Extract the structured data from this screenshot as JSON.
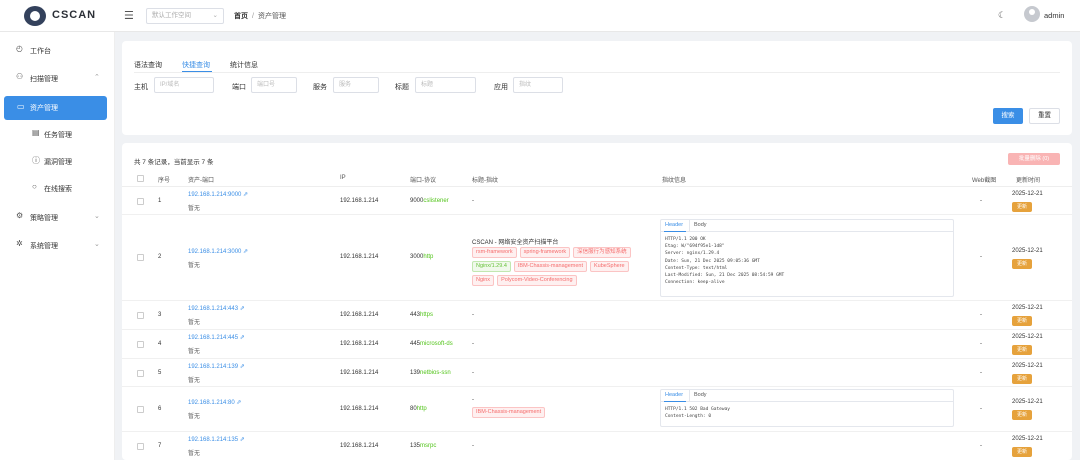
{
  "app": {
    "logo_text": "CSCAN"
  },
  "topbar": {
    "workspace_placeholder": "默认工作空间",
    "breadcrumb": [
      "首页",
      "资产管理"
    ],
    "breadcrumb_sep": "/",
    "user": "admin"
  },
  "sidebar": {
    "items": [
      {
        "label": "工作台",
        "icon": "dashboard-icon"
      },
      {
        "label": "扫描管理",
        "icon": "scan-icon",
        "arrow": "⌃"
      },
      {
        "label": "资产管理",
        "icon": "monitor-icon",
        "active": true
      },
      {
        "label": "任务管理",
        "icon": "task-icon"
      },
      {
        "label": "漏洞管理",
        "icon": "vuln-icon"
      },
      {
        "label": "在线搜索",
        "icon": "search-icon"
      },
      {
        "label": "策略管理",
        "icon": "policy-icon",
        "arrow": "⌄"
      },
      {
        "label": "系统管理",
        "icon": "gear-icon",
        "arrow": "⌄"
      }
    ]
  },
  "search": {
    "tabs": [
      "语法查询",
      "快捷查询",
      "统计信息"
    ],
    "active_tab": "快捷查询",
    "fields": [
      {
        "label": "主机",
        "placeholder": "IP/域名"
      },
      {
        "label": "端口",
        "placeholder": "端口号"
      },
      {
        "label": "服务",
        "placeholder": "服务"
      },
      {
        "label": "标题",
        "placeholder": "标题"
      },
      {
        "label": "应用",
        "placeholder": "指纹"
      }
    ],
    "search_button": "搜索",
    "reset_button": "重置"
  },
  "table": {
    "count_text": "共 7 条记录，当前显示 7 条",
    "batch_delete": "批量删除 (0)",
    "columns": [
      "序号",
      "资产-端口",
      "IP",
      "端口-协议",
      "标题-指纹",
      "指纹信息",
      "Web截图",
      "更新时间"
    ],
    "rows": [
      {
        "no": "1",
        "asset": "192.168.1.214:9000",
        "sub": "暂无",
        "ip": "192.168.1.214",
        "port": "9000",
        "service": "cslistener",
        "title": "-",
        "screenshot": "-",
        "date": "2025-12-21",
        "badge": "更新"
      },
      {
        "no": "2",
        "asset": "192.168.1.214:3000",
        "sub": "暂无",
        "ip": "192.168.1.214",
        "port": "3000",
        "service": "http",
        "title": "CSCAN - 网络安全资产扫描平台",
        "tags": [
          {
            "text": "rsm-framework",
            "color": "red"
          },
          {
            "text": "spring-framework",
            "color": "red"
          },
          {
            "text": "深信服行为感知系统",
            "color": "red"
          },
          {
            "text": "Nginx/1.29.4",
            "color": "green"
          },
          {
            "text": "IBM-Chassis-management",
            "color": "red"
          },
          {
            "text": "KubeSphere",
            "color": "red"
          },
          {
            "text": "Nginx",
            "color": "red"
          },
          {
            "text": "Polycom-Video-Conferencing",
            "color": "red"
          }
        ],
        "header_tabs": [
          "Header",
          "Body"
        ],
        "header": "HTTP/1.1 200 OK\nEtag: W/\"694f95e1-1d8\"\nServer: nginx/1.29.4\nDate: Sun, 21 Dec 2025 09:05:36 GMT\nContent-Type: text/html\nLast-Modified: Sun, 21 Dec 2025 08:54:59 GMT\nConnection: keep-alive",
        "screenshot": "-",
        "date": "2025-12-21",
        "badge": "更新"
      },
      {
        "no": "3",
        "asset": "192.168.1.214:443",
        "sub": "暂无",
        "ip": "192.168.1.214",
        "port": "443",
        "service": "https",
        "title": "-",
        "screenshot": "-",
        "date": "2025-12-21",
        "badge": "更新"
      },
      {
        "no": "4",
        "asset": "192.168.1.214:445",
        "sub": "暂无",
        "ip": "192.168.1.214",
        "port": "445",
        "service": "microsoft-ds",
        "title": "-",
        "screenshot": "-",
        "date": "2025-12-21",
        "badge": "更新"
      },
      {
        "no": "5",
        "asset": "192.168.1.214:139",
        "sub": "暂无",
        "ip": "192.168.1.214",
        "port": "139",
        "service": "netbios-ssn",
        "title": "-",
        "screenshot": "-",
        "date": "2025-12-21",
        "badge": "更新"
      },
      {
        "no": "6",
        "asset": "192.168.1.214:80",
        "sub": "暂无",
        "ip": "192.168.1.214",
        "port": "80",
        "service": "http",
        "title": "-",
        "tags": [
          {
            "text": "IBM-Chassis-management",
            "color": "red"
          }
        ],
        "header_tabs": [
          "Header",
          "Body"
        ],
        "header": "HTTP/1.1 502 Bad Gateway\nContent-Length: 0",
        "screenshot": "-",
        "date": "2025-12-21",
        "badge": "更新"
      },
      {
        "no": "7",
        "asset": "192.168.1.214:135",
        "sub": "暂无",
        "ip": "192.168.1.214",
        "port": "135",
        "service": "msrpc",
        "title": "-",
        "screenshot": "-",
        "date": "2025-12-21",
        "badge": "更新"
      }
    ]
  },
  "colors": {
    "primary": "#3a8ee6",
    "badge": "#e6a23c",
    "service": "#52c41a",
    "danger": "#f56c6c"
  }
}
